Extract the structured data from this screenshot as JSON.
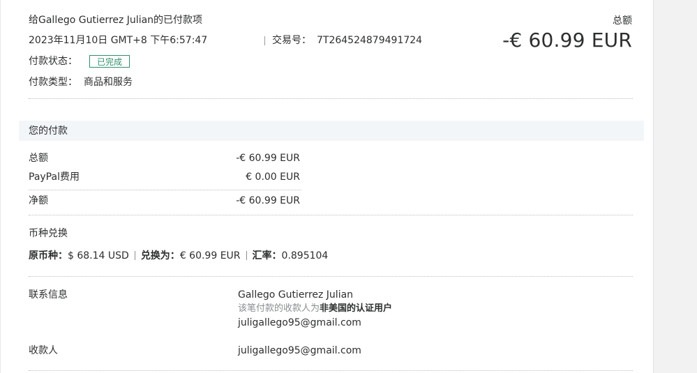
{
  "header": {
    "title": "给Gallego Gutierrez Julian的已付款项",
    "total_label": "总额",
    "date": "2023年11月10日 GMT+8 下午6:57:47",
    "transaction_label": "交易号：",
    "transaction_id": "7T264524879491724",
    "amount": "-€ 60.99 EUR",
    "status_label": "付款状态：",
    "status_value": "已完成",
    "type_label": "付款类型：",
    "type_value": "商品和服务"
  },
  "payment": {
    "section_title": "您的付款",
    "rows": [
      {
        "label": "总额",
        "value": "-€ 60.99 EUR"
      },
      {
        "label": "PayPal费用",
        "value": "€ 0.00 EUR"
      },
      {
        "label": "净额",
        "value": "-€ 60.99 EUR"
      }
    ]
  },
  "conversion": {
    "title": "币种兑换",
    "original_label": "原币种：",
    "original_value": "$ 68.14 USD",
    "converted_label": "兑换为：",
    "converted_value": "€ 60.99 EUR",
    "rate_label": "汇率：",
    "rate_value": "0.895104"
  },
  "contact": {
    "label": "联系信息",
    "name": "Gallego Gutierrez Julian",
    "note_prefix": "该笔付款的收款人为",
    "note_bold": "非美国的认证用户",
    "email": "juligallego95@gmail.com"
  },
  "recipient": {
    "label": "收款人",
    "email": "juligallego95@gmail.com"
  }
}
